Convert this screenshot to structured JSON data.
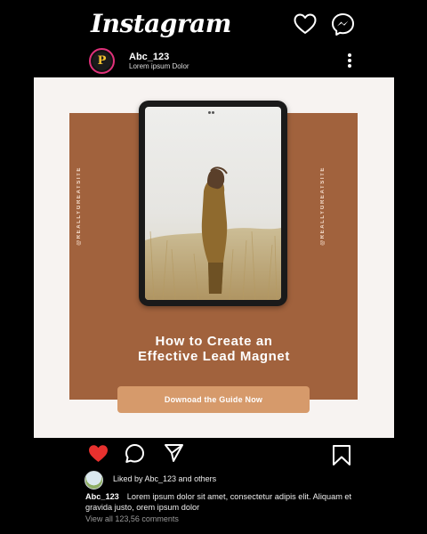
{
  "app": {
    "logo_text": "Instagram"
  },
  "post_header": {
    "username": "Abc_123",
    "subtitle": "Lorem ipsum Dolor",
    "avatar_letter": "P"
  },
  "post": {
    "side_text_left": "@REALLYGREATSITE",
    "side_text_right": "@REALLYGREATSITE",
    "headline_line1": "How to Create an",
    "headline_line2": "Effective Lead Magnet",
    "cta_label": "Downoad the Guide Now"
  },
  "engagement": {
    "liked_by": "Liked by Abc_123 and others",
    "caption_user": "Abc_123",
    "caption_text": "Lorem ipsum dolor sit amet, consectetur adipis elit. Aliquam et gravida justo, orem ipsum dolor",
    "view_all": "View all 123,56 comments"
  },
  "colors": {
    "background": "#000000",
    "panel_brown": "#a1623d",
    "post_bg": "#f7f3f1",
    "cta_bg": "#d69a6b",
    "like_red": "#e8312e"
  },
  "icons": [
    "heart-icon",
    "messenger-icon",
    "more-options-icon",
    "comment-icon",
    "share-icon",
    "bookmark-icon"
  ]
}
